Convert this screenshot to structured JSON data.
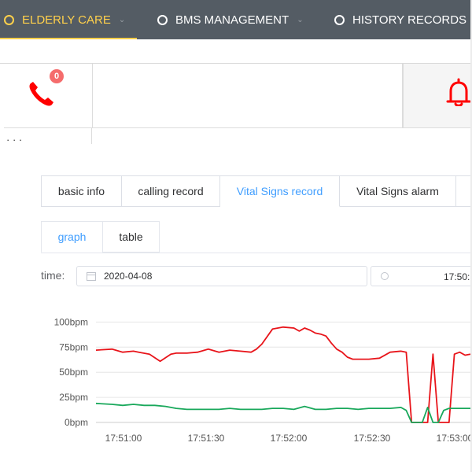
{
  "topnav": {
    "items": [
      {
        "label": "ELDERLY CARE",
        "active": true,
        "has_chevron": true
      },
      {
        "label": "BMS MANAGEMENT",
        "active": false,
        "has_chevron": true
      },
      {
        "label": "HISTORY RECORDS",
        "active": false,
        "has_chevron": false
      }
    ],
    "accent_color": "#ffd04b",
    "background": "#545c64"
  },
  "alert_row": {
    "phone": {
      "icon": "phone-icon",
      "badge": "0",
      "color": "#ff0000"
    },
    "bell": {
      "icon": "bell-icon",
      "color": "#ff0000"
    },
    "cut_text": "· · ·"
  },
  "tabs": [
    {
      "label": "basic info",
      "active": false
    },
    {
      "label": "calling record",
      "active": false
    },
    {
      "label": "Vital Signs record",
      "active": true
    },
    {
      "label": "Vital Signs alarm",
      "active": false
    }
  ],
  "subtabs": [
    {
      "label": "graph",
      "active": true
    },
    {
      "label": "table",
      "active": false
    }
  ],
  "filter": {
    "time_label": "time:",
    "date_value": "2020-04-08",
    "time_value": "17:50:"
  },
  "chart_data": {
    "type": "line",
    "y_ticks": [
      "0bpm",
      "25bpm",
      "50bpm",
      "75bpm",
      "100bpm"
    ],
    "x_ticks": [
      "17:51:00",
      "17:51:30",
      "17:52:00",
      "17:52:30",
      "17:53:00"
    ],
    "ylim": [
      0,
      105
    ],
    "xlim_seconds": [
      -5,
      65
    ],
    "grid": "horizontal",
    "series": [
      {
        "color": "#e8141a",
        "x": [
          -5,
          -2,
          0,
          2,
          3,
          5,
          7,
          9,
          10,
          12,
          14,
          16,
          18,
          20,
          22,
          24,
          25,
          26,
          28,
          30,
          32,
          33,
          34,
          35,
          36,
          37,
          38,
          39,
          40,
          41,
          42,
          43,
          44,
          46,
          48,
          50,
          52,
          53,
          54,
          55,
          56,
          57,
          58,
          59,
          60,
          61,
          62,
          63,
          64,
          65
        ],
        "y": [
          72,
          73,
          70,
          71,
          70,
          68,
          61,
          68,
          69,
          69,
          70,
          73,
          70,
          72,
          71,
          70,
          73,
          78,
          93,
          95,
          94,
          91,
          94,
          92,
          89,
          88,
          86,
          79,
          73,
          70,
          65,
          63,
          63,
          63,
          64,
          70,
          71,
          70,
          0,
          0,
          0,
          0,
          68,
          0,
          0,
          0,
          68,
          70,
          67,
          68
        ]
      },
      {
        "color": "#19a85b",
        "x": [
          -5,
          -2,
          0,
          2,
          4,
          6,
          8,
          10,
          12,
          14,
          16,
          18,
          20,
          22,
          24,
          26,
          28,
          30,
          32,
          34,
          36,
          38,
          40,
          42,
          44,
          46,
          48,
          50,
          52,
          53,
          54,
          55,
          56,
          57,
          58,
          59,
          60,
          61,
          62,
          63,
          64,
          65
        ],
        "y": [
          19,
          18,
          17,
          18,
          17,
          17,
          16,
          14,
          13,
          13,
          13,
          13,
          14,
          13,
          13,
          13,
          14,
          14,
          13,
          16,
          13,
          13,
          14,
          14,
          13,
          14,
          14,
          14,
          15,
          12,
          0,
          0,
          0,
          15,
          0,
          0,
          12,
          14,
          14,
          14,
          14,
          14
        ]
      }
    ]
  }
}
